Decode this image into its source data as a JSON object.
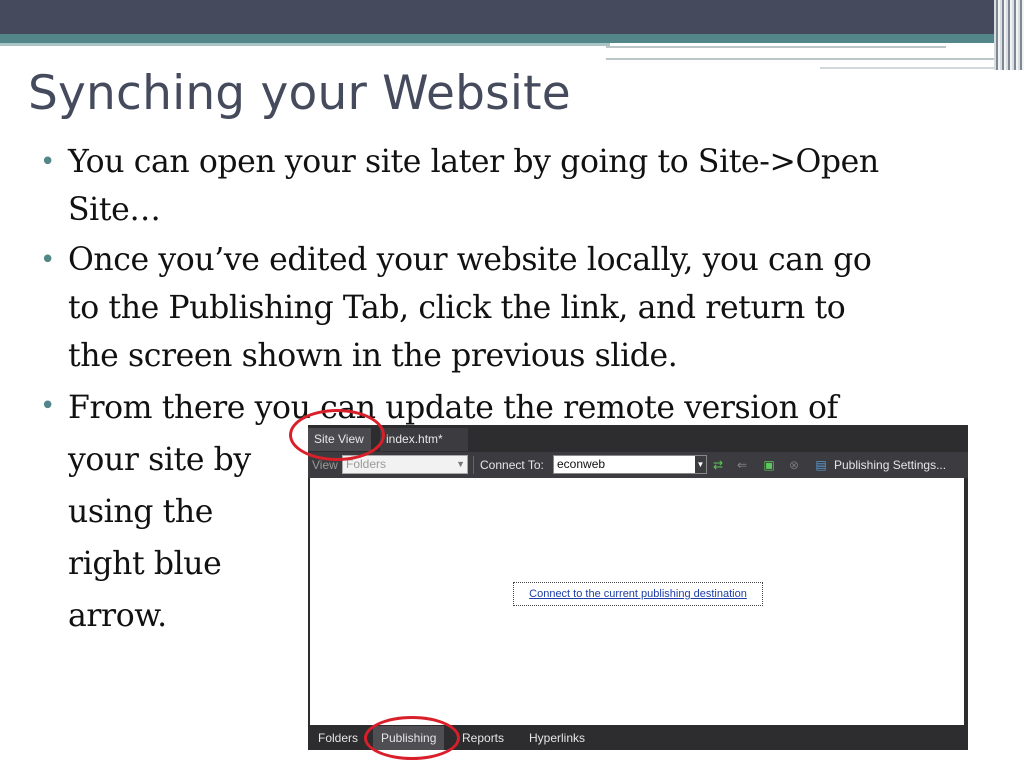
{
  "slide": {
    "title": "Synching your Website",
    "bullets": [
      {
        "lines": [
          "You can open your site later by going to Site->Open",
          "Site…"
        ]
      },
      {
        "lines": [
          "Once you’ve edited your website locally, you can go",
          "to the Publishing Tab, click the link, and return to",
          "the screen shown in the previous slide."
        ]
      },
      {
        "lines": [
          "From there you can update the remote version of",
          "your site by",
          "using the",
          "right blue",
          "arrow."
        ]
      }
    ]
  },
  "app": {
    "tabs": [
      {
        "label": "Site View",
        "active": true
      },
      {
        "label": "index.htm*",
        "active": false
      }
    ],
    "toolbar": {
      "view_label": "View",
      "view_value": "Folders",
      "connect_label": "Connect To:",
      "connect_value": "econweb",
      "publishing_settings_label": "Publishing Settings..."
    },
    "content": {
      "publish_link": "Connect to the current publishing destination"
    },
    "bottom_tabs": [
      {
        "label": "Folders",
        "selected": false
      },
      {
        "label": "Publishing",
        "selected": true
      },
      {
        "label": "Reports",
        "selected": false
      },
      {
        "label": "Hyperlinks",
        "selected": false
      }
    ]
  },
  "colors": {
    "title": "#454b5d",
    "bullet": "#538689",
    "annotation_ring": "#d9202a",
    "link": "#1f3fa8"
  }
}
